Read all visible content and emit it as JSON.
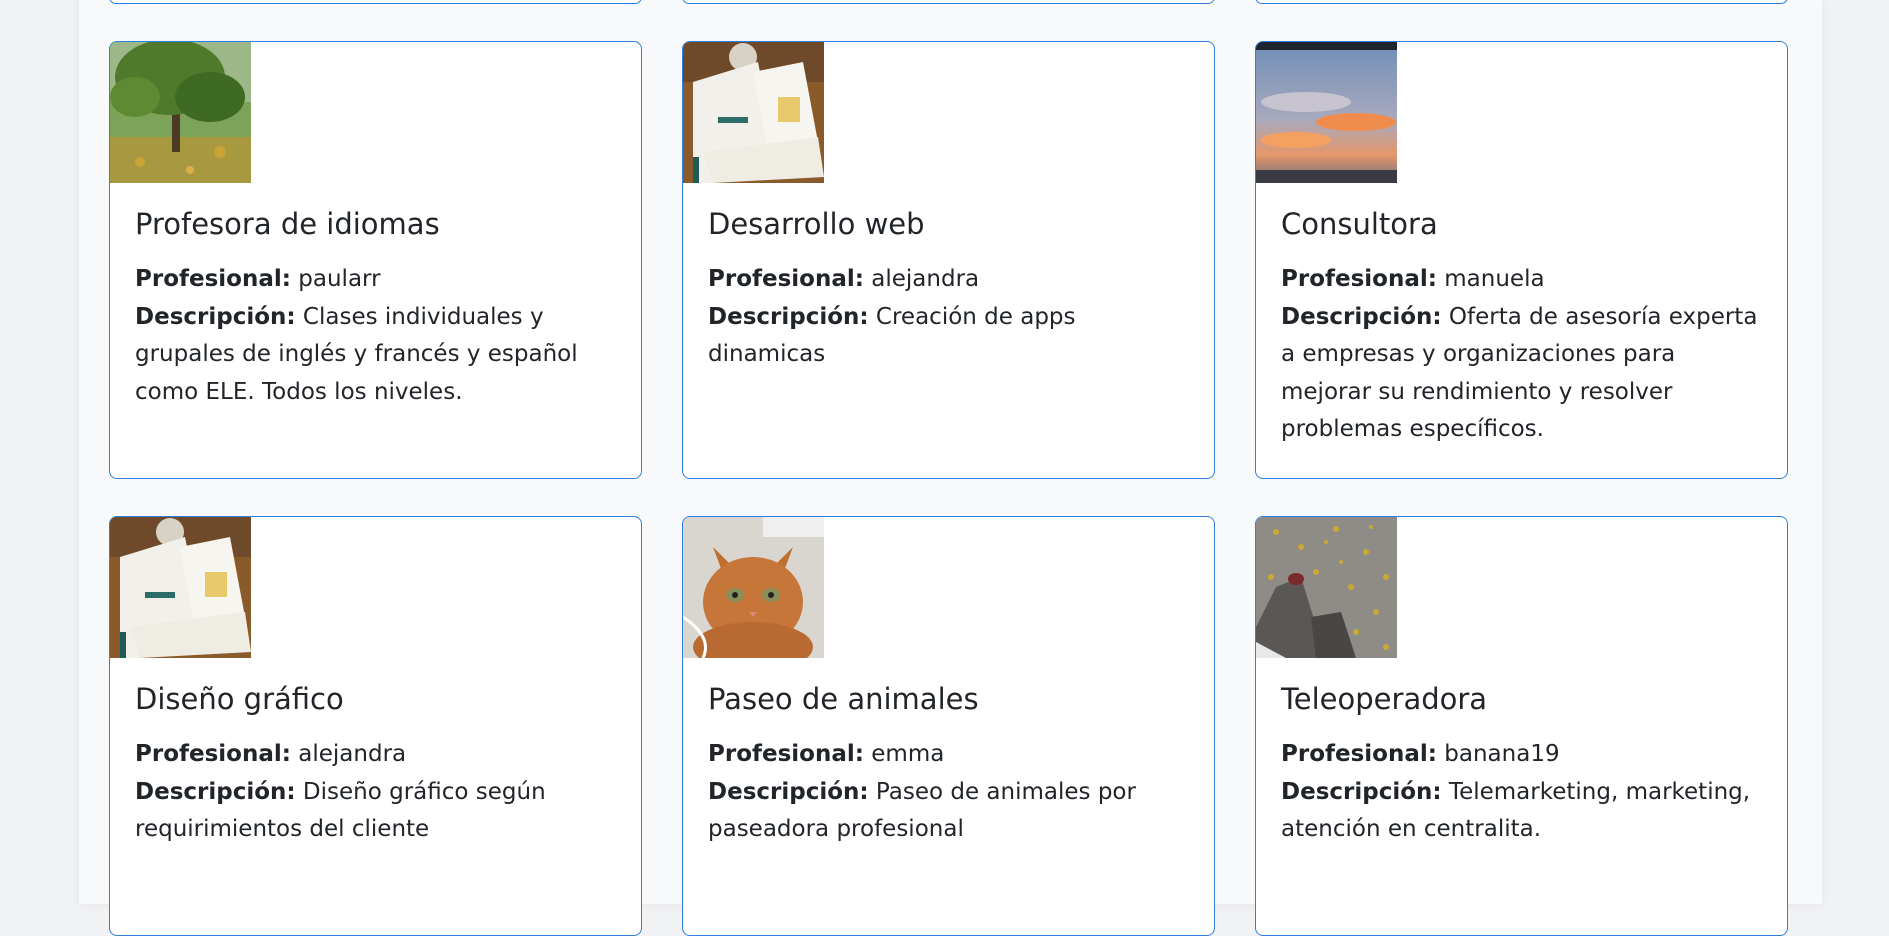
{
  "labels": {
    "professional": "Profesional:",
    "description": "Descripción:"
  },
  "services": [
    {
      "title": "Profesora de idiomas",
      "professional": "paularr",
      "description": "Clases individuales y grupales de inglés y francés y español como ELE. Todos los niveles.",
      "image_icon": "tree-park-photo-icon"
    },
    {
      "title": "Desarrollo web",
      "professional": "alejandra",
      "description": "Creación de apps dinamicas",
      "image_icon": "business-cards-photo-icon"
    },
    {
      "title": "Consultora",
      "professional": "manuela",
      "description": "Oferta de asesoría experta a empresas y organizaciones para mejorar su rendimiento y resolver problemas específicos.",
      "image_icon": "sunset-sky-photo-icon"
    },
    {
      "title": "Diseño gráfico",
      "professional": "alejandra",
      "description": "Diseño gráfico según requirimientos del cliente",
      "image_icon": "business-cards-photo-icon"
    },
    {
      "title": "Paseo de animales",
      "professional": "emma",
      "description": "Paseo de animales por paseadora profesional",
      "image_icon": "orange-cat-photo-icon"
    },
    {
      "title": "Teleoperadora",
      "professional": "banana19",
      "description": "Telemarketing, marketing, atención en centralita.",
      "image_icon": "autumn-leaves-pavement-photo-icon"
    }
  ],
  "colors": {
    "card_border": "#2f7fe0",
    "page_background": "#f8f9fb"
  }
}
